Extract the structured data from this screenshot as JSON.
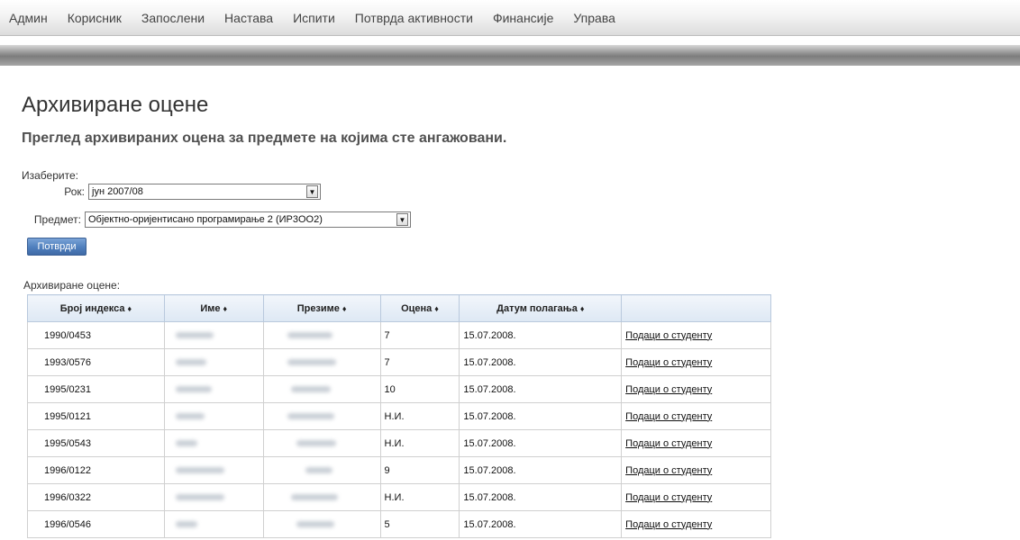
{
  "nav": {
    "items": [
      "Админ",
      "Корисник",
      "Запослени",
      "Настава",
      "Испити",
      "Потврда активности",
      "Финансије",
      "Управа"
    ]
  },
  "page": {
    "title": "Архивиране оцене",
    "subtitle": "Преглед архивираних оцена за предмете на којима сте ангажовани."
  },
  "form": {
    "choose_label": "Изаберите:",
    "rok_label": "Рок:",
    "rok_value": "јун 2007/08",
    "predmet_label": "Предмет:",
    "predmet_value": "Објектно-оријентисано програмирање 2 (ИР3ОО2)",
    "submit_label": "Потврди",
    "dropdown_glyph": "▼"
  },
  "table": {
    "caption": "Архивиране оцене:",
    "sort_glyph": "♦",
    "headers": [
      "Број индекса",
      "Име",
      "Презиме",
      "Оцена",
      "Датум полагања",
      ""
    ],
    "link_label": "Подаци о студенту",
    "rows": [
      {
        "index": "1990/0453",
        "grade": "7",
        "date": "15.07.2008."
      },
      {
        "index": "1993/0576",
        "grade": "7",
        "date": "15.07.2008."
      },
      {
        "index": "1995/0231",
        "grade": "10",
        "date": "15.07.2008."
      },
      {
        "index": "1995/0121",
        "grade": "Н.И.",
        "date": "15.07.2008."
      },
      {
        "index": "1995/0543",
        "grade": "Н.И.",
        "date": "15.07.2008."
      },
      {
        "index": "1996/0122",
        "grade": "9",
        "date": "15.07.2008."
      },
      {
        "index": "1996/0322",
        "grade": "Н.И.",
        "date": "15.07.2008."
      },
      {
        "index": "1996/0546",
        "grade": "5",
        "date": "15.07.2008."
      }
    ]
  },
  "colors": {
    "header_bg": "#dde8f4",
    "button_bg": "#4f7fbd",
    "subbar": "#7c7c7c"
  }
}
